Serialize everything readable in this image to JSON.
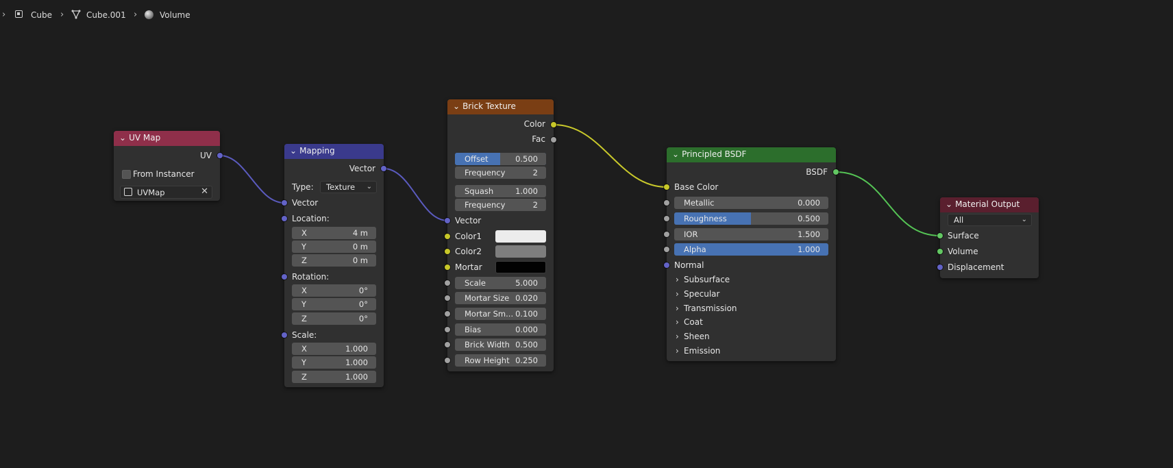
{
  "breadcrumb": {
    "items": [
      {
        "label": "Cube",
        "icon": "object-icon"
      },
      {
        "label": "Cube.001",
        "icon": "mesh-icon"
      },
      {
        "label": "Volume",
        "icon": "material-icon"
      }
    ]
  },
  "colors": {
    "vector_socket": "#6363c7",
    "color_socket": "#c7c729",
    "float_socket": "#a1a1a1",
    "shader_socket": "#63c763",
    "accent_blue": "#4772b3"
  },
  "uv_map": {
    "title": "UV Map",
    "header_color": "#8f2f4a",
    "output_uv": "UV",
    "from_instancer": "From Instancer",
    "uvmap_value": "UVMap"
  },
  "mapping": {
    "title": "Mapping",
    "header_color": "#3a3a8c",
    "output_vector": "Vector",
    "type_label": "Type:",
    "type_value": "Texture",
    "input_vector": "Vector",
    "location_label": "Location:",
    "location": [
      {
        "axis": "X",
        "value": "4 m"
      },
      {
        "axis": "Y",
        "value": "0 m"
      },
      {
        "axis": "Z",
        "value": "0 m"
      }
    ],
    "rotation_label": "Rotation:",
    "rotation": [
      {
        "axis": "X",
        "value": "0°"
      },
      {
        "axis": "Y",
        "value": "0°"
      },
      {
        "axis": "Z",
        "value": "0°"
      }
    ],
    "scale_label": "Scale:",
    "scale": [
      {
        "axis": "X",
        "value": "1.000"
      },
      {
        "axis": "Y",
        "value": "1.000"
      },
      {
        "axis": "Z",
        "value": "1.000"
      }
    ]
  },
  "brick": {
    "title": "Brick Texture",
    "header_color": "#7a3e14",
    "out_color": "Color",
    "out_fac": "Fac",
    "offset_label": "Offset",
    "offset_value": "0.500",
    "freq1_label": "Frequency",
    "freq1_value": "2",
    "squash_label": "Squash",
    "squash_value": "1.000",
    "freq2_label": "Frequency",
    "freq2_value": "2",
    "in_vector": "Vector",
    "color1": "Color1",
    "color1_swatch": "#ececec",
    "color2": "Color2",
    "color2_swatch": "#7e7e7e",
    "mortar": "Mortar",
    "mortar_swatch": "#020202",
    "params": [
      {
        "label": "Scale",
        "value": "5.000"
      },
      {
        "label": "Mortar Size",
        "value": "0.020"
      },
      {
        "label": "Mortar Sm...",
        "value": "0.100"
      },
      {
        "label": "Bias",
        "value": "0.000"
      },
      {
        "label": "Brick Width",
        "value": "0.500"
      },
      {
        "label": "Row Height",
        "value": "0.250"
      }
    ]
  },
  "bsdf": {
    "title": "Principled BSDF",
    "header_color": "#2c6e2c",
    "out_bsdf": "BSDF",
    "base_color": "Base Color",
    "metallic_label": "Metallic",
    "metallic_value": "0.000",
    "roughness_label": "Roughness",
    "roughness_value": "0.500",
    "ior_label": "IOR",
    "ior_value": "1.500",
    "alpha_label": "Alpha",
    "alpha_value": "1.000",
    "normal": "Normal",
    "panels": [
      "Subsurface",
      "Specular",
      "Transmission",
      "Coat",
      "Sheen",
      "Emission"
    ]
  },
  "output": {
    "title": "Material Output",
    "header_color": "#5a1f2e",
    "target": "All",
    "surface": "Surface",
    "volume": "Volume",
    "displacement": "Displacement"
  }
}
